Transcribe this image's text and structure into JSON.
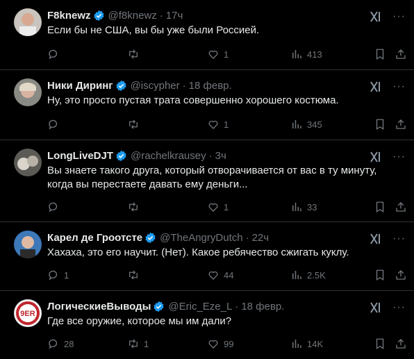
{
  "colors": {
    "background": "#000000",
    "text": "#e7e9ea",
    "muted": "#71767b",
    "verified": "#1d9bf0",
    "divider": "#2f3336"
  },
  "tweets": [
    {
      "name": "F8knewz",
      "handle": "@f8knewz",
      "time": "17ч",
      "text": "Если бы не США, вы бы уже были Россией.",
      "replies": "",
      "retweets": "",
      "likes": "1",
      "views": "413"
    },
    {
      "name": "Ники Диринг",
      "handle": "@iscypher",
      "time": "18 февр.",
      "text": "Ну, это просто пустая трата совершенно хорошего костюма.",
      "replies": "",
      "retweets": "",
      "likes": "1",
      "views": "345"
    },
    {
      "name": "LongLiveDJT",
      "handle": "@rachelkrausey",
      "time": "3ч",
      "text": "Вы знаете такого друга, который отворачивается от вас в ту минуту, когда вы перестаете давать ему деньги...",
      "replies": "",
      "retweets": "",
      "likes": "1",
      "views": "33"
    },
    {
      "name": "Карел де Гроотсте",
      "handle": "@TheAngryDutch",
      "time": "22ч",
      "text": "Хахаха, это его научит. (Нет). Какое ребячество сжигать куклу.",
      "replies": "1",
      "retweets": "",
      "likes": "44",
      "views": "2.5K"
    },
    {
      "name": "ЛогическиеВыводы",
      "handle": "@Eric_Eze_L",
      "time": "18 февр.",
      "text": "Где все оружие, которое мы им дали?",
      "replies": "28",
      "retweets": "1",
      "likes": "99",
      "views": "14K"
    }
  ]
}
